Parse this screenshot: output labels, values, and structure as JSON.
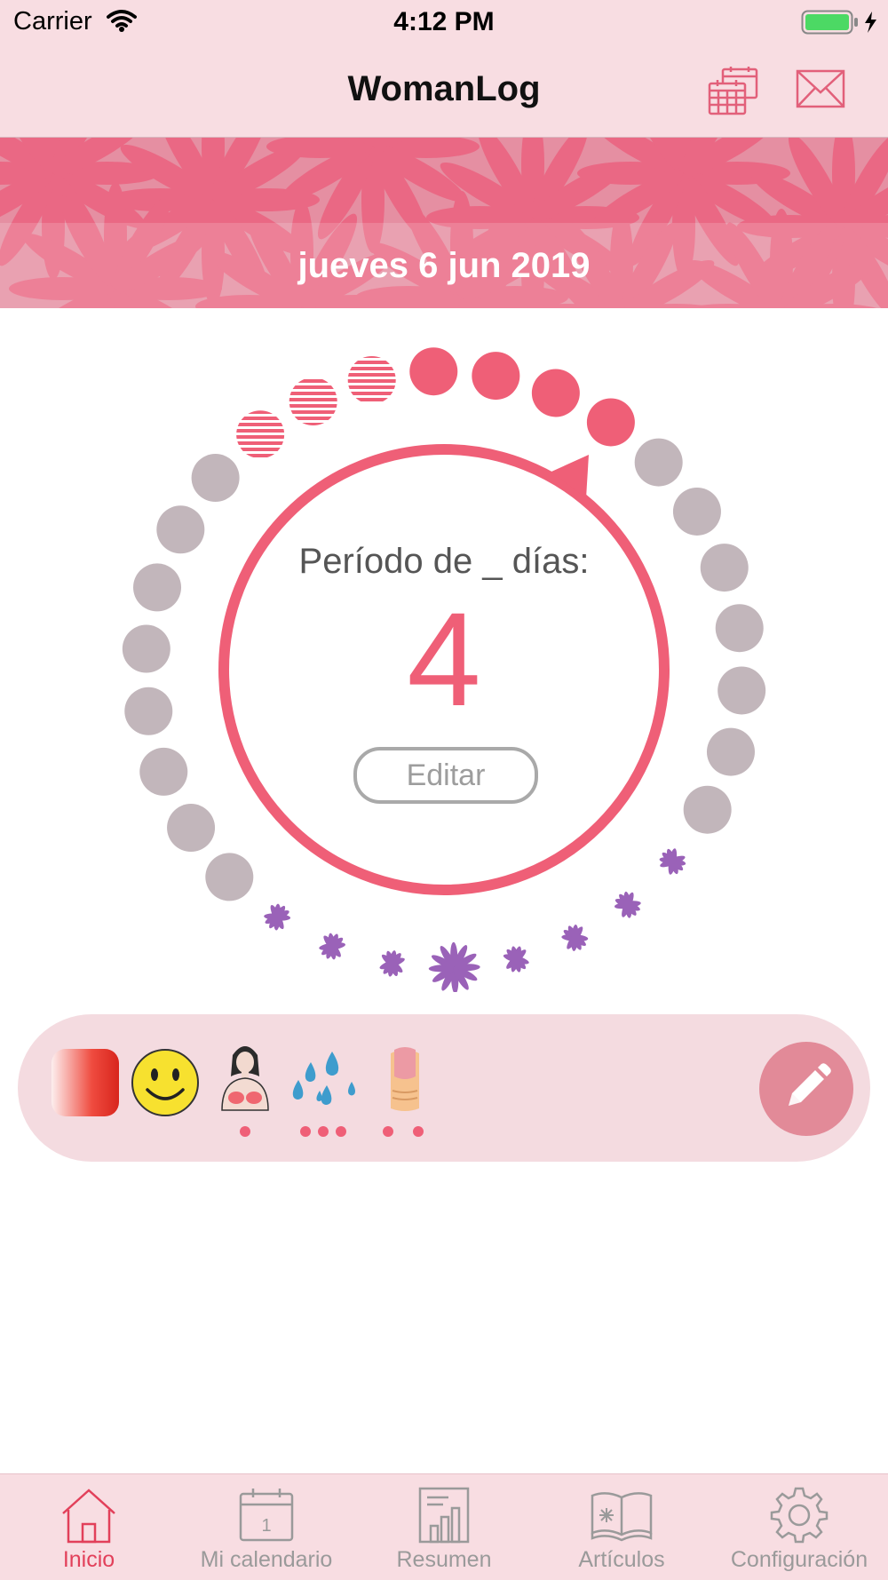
{
  "status_bar": {
    "carrier": "Carrier",
    "time": "4:12 PM",
    "battery_icon": "battery-charging-icon"
  },
  "header": {
    "title": "WomanLog",
    "calendar_icon": "calendar-icon",
    "mail_icon": "mail-icon"
  },
  "banner": {
    "date": "jueves 6 jun 2019"
  },
  "cycle": {
    "label": "Período de _ días:",
    "value": "4",
    "edit_label": "Editar"
  },
  "symptoms": {
    "items": [
      "period-flow-icon",
      "mood-smiley-icon",
      "breast-tenderness-icon",
      "discharge-drops-icon",
      "nail-icon"
    ],
    "edit_icon": "pencil-icon"
  },
  "tab_bar": {
    "tabs": [
      {
        "label": "Inicio",
        "icon": "home-icon",
        "active": true
      },
      {
        "label": "Mi calendario",
        "icon": "calendar-day-icon",
        "active": false
      },
      {
        "label": "Resumen",
        "icon": "report-icon",
        "active": false
      },
      {
        "label": "Artículos",
        "icon": "book-icon",
        "active": false
      },
      {
        "label": "Configuración",
        "icon": "gear-icon",
        "active": false
      }
    ]
  },
  "colors": {
    "accent": "#ef5f77",
    "status_bar_bg": "#f8dde2",
    "grey_dot": "#c2b6bb",
    "purple_flower": "#9a62b8",
    "active_tab": "#e2405a"
  }
}
